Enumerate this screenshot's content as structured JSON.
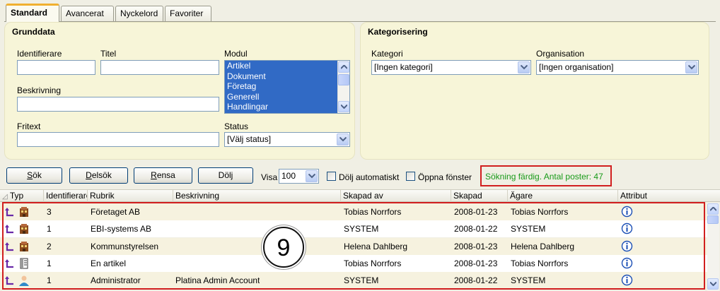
{
  "tabs": [
    "Standard",
    "Avancerat",
    "Nyckelord",
    "Favoriter"
  ],
  "grunddata": {
    "title": "Grunddata",
    "identifier_label": "Identifierare",
    "identifier_value": "",
    "title_label": "Titel",
    "title_value": "",
    "module_label": "Modul",
    "module_options": [
      "Artikel",
      "Dokument",
      "Företag",
      "Generell",
      "Handlingar"
    ],
    "description_label": "Beskrivning",
    "description_value": "",
    "freetext_label": "Fritext",
    "freetext_value": "",
    "status_label": "Status",
    "status_value": "[Välj status]"
  },
  "kategorisering": {
    "title": "Kategorisering",
    "category_label": "Kategori",
    "category_value": "[Ingen kategori]",
    "organisation_label": "Organisation",
    "organisation_value": "[Ingen organisation]"
  },
  "toolbar": {
    "search_prefix": "S",
    "search_rest": "ök",
    "partial_prefix": "D",
    "partial_rest": "elsök",
    "clear_prefix": "R",
    "clear_rest": "ensa",
    "hide_label": "Dölj",
    "show_label": "Visa",
    "show_value": "100",
    "auto_hide_label": "Dölj automatiskt",
    "open_window_label": "Öppna fönster",
    "status_text": "Sökning färdig. Antal poster: 47"
  },
  "grid": {
    "columns": [
      "Typ",
      "Identifierare",
      "Rubrik",
      "Beskrivning",
      "Skapad av",
      "Skapad",
      "Ägare",
      "Attribut"
    ],
    "rows": [
      {
        "id": "3",
        "rubrik": "Företaget AB",
        "beskrivning": "",
        "skapad_av": "Tobias Norrfors",
        "skapad": "2008-01-23",
        "agare": "Tobias Norrfors",
        "icon": "company-icon"
      },
      {
        "id": "1",
        "rubrik": "EBI-systems AB",
        "beskrivning": "",
        "skapad_av": "SYSTEM",
        "skapad": "2008-01-22",
        "agare": "SYSTEM",
        "icon": "company-icon"
      },
      {
        "id": "2",
        "rubrik": "Kommunstyrelsen",
        "beskrivning": "",
        "skapad_av": "Helena Dahlberg",
        "skapad": "2008-01-23",
        "agare": "Helena Dahlberg",
        "icon": "company-icon"
      },
      {
        "id": "1",
        "rubrik": "En artikel",
        "beskrivning": "",
        "skapad_av": "Tobias Norrfors",
        "skapad": "2008-01-23",
        "agare": "Tobias Norrfors",
        "icon": "article-icon"
      },
      {
        "id": "1",
        "rubrik": "Administrator",
        "beskrivning": "Platina Admin Account",
        "skapad_av": "SYSTEM",
        "skapad": "2008-01-22",
        "agare": "SYSTEM",
        "icon": "user-icon"
      }
    ]
  },
  "annotation_number": "9",
  "colors": {
    "panel": "#f7f5d8",
    "highlight": "#d11f1f",
    "status_green": "#189a18",
    "selection": "#316ac5"
  }
}
